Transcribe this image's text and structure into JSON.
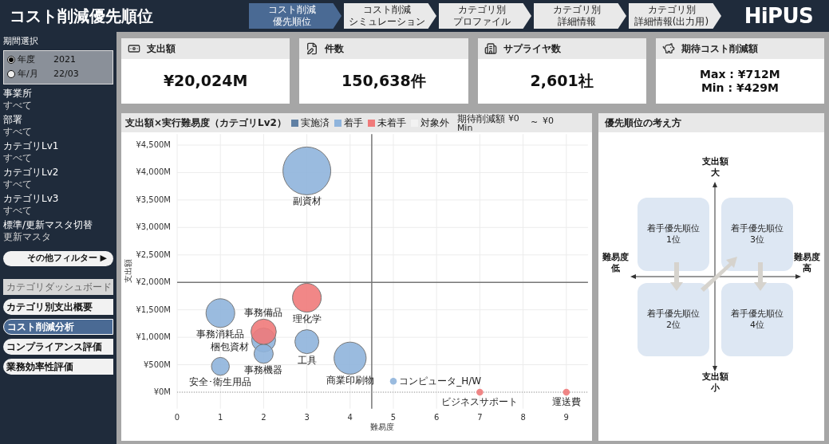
{
  "header": {
    "title": "コスト削減優先順位",
    "logo": "HiPUS"
  },
  "steps": [
    {
      "lines": [
        "コスト削減",
        "優先順位"
      ],
      "selected": true
    },
    {
      "lines": [
        "コスト削減",
        "シミュレーション"
      ],
      "selected": false
    },
    {
      "lines": [
        "カテゴリ別",
        "プロファイル"
      ],
      "selected": false
    },
    {
      "lines": [
        "カテゴリ別",
        "詳細情報"
      ],
      "selected": false
    },
    {
      "lines": [
        "カテゴリ別",
        "詳細情報(出力用)"
      ],
      "selected": false
    }
  ],
  "sidebar": {
    "period": {
      "label": "期間選択",
      "options": [
        {
          "label": "年度",
          "value": "2021",
          "selected": true
        },
        {
          "label": "年/月",
          "value": "22/03",
          "selected": false
        }
      ]
    },
    "filters": [
      {
        "label": "事業所",
        "value": "すべて"
      },
      {
        "label": "部署",
        "value": "すべて"
      },
      {
        "label": "カテゴリLv1",
        "value": "すべて"
      },
      {
        "label": "カテゴリLv2",
        "value": "すべて"
      },
      {
        "label": "カテゴリLv3",
        "value": "すべて"
      },
      {
        "label": "標準/更新マスタ切替",
        "value": "更新マスタ"
      }
    ],
    "more_filters": "その他フィルター ▶",
    "nav": [
      {
        "label": "カテゴリダッシュボード",
        "selected": false,
        "disabled": true
      },
      {
        "label": "カテゴリ別支出概要",
        "selected": false,
        "disabled": false
      },
      {
        "label": "コスト削減分析",
        "selected": true,
        "disabled": false
      },
      {
        "label": "コンプライアンス評価",
        "selected": false,
        "disabled": false
      },
      {
        "label": "業務効率性評価",
        "selected": false,
        "disabled": false
      }
    ]
  },
  "kpis": [
    {
      "kind": "money",
      "title": "支出額",
      "values": [
        "¥20,024M"
      ]
    },
    {
      "kind": "document",
      "title": "件数",
      "values": [
        "150,638件"
      ]
    },
    {
      "kind": "building",
      "title": "サプライヤ数",
      "values": [
        "2,601社"
      ]
    },
    {
      "kind": "piggy",
      "title": "期待コスト削減額",
      "values": [
        "Max : ¥712M",
        "Min : ¥429M"
      ]
    }
  ],
  "chart_panel": {
    "title": "支出額×実行難易度（カテゴリLv2）",
    "legend_before": [
      {
        "label": "実施済",
        "color": "#5f7fa3"
      }
    ],
    "legend_after": [
      {
        "label": "対象外",
        "color": "#f2f2f2"
      }
    ],
    "filter": {
      "label": "期待削減額",
      "min_value": "¥0",
      "min_label": "Min",
      "separator": "~",
      "max_value": "¥0"
    },
    "chart_data": {
      "type": "scatter",
      "xlabel": "難易度",
      "ylabel": "支出額",
      "xlim": [
        0,
        9.5
      ],
      "ylim": [
        -300,
        4700
      ],
      "grid": true,
      "xticks": [
        0,
        1,
        2,
        3,
        4,
        5,
        6,
        7,
        8,
        9
      ],
      "yticks": [
        {
          "value": 0,
          "label": "¥0M"
        },
        {
          "value": 500,
          "label": "¥500M"
        },
        {
          "value": 1000,
          "label": "¥1,000M"
        },
        {
          "value": 1500,
          "label": "¥1,500M"
        },
        {
          "value": 2000,
          "label": "¥2,000M"
        },
        {
          "value": 2500,
          "label": "¥2,500M"
        },
        {
          "value": 3000,
          "label": "¥3,000M"
        },
        {
          "value": 3500,
          "label": "¥3,500M"
        },
        {
          "value": 4000,
          "label": "¥4,000M"
        },
        {
          "value": 4500,
          "label": "¥4,500M"
        }
      ],
      "series": [
        {
          "name": "着手",
          "color": "#8fb4dc",
          "x": [
            3,
            1,
            2,
            2,
            3,
            1,
            4,
            5
          ],
          "values": [
            4030,
            1440,
            950,
            700,
            920,
            470,
            620,
            200
          ],
          "sizes": [
            1,
            0.36,
            0.25,
            0.16,
            0.25,
            0.14,
            0.45,
            0.02
          ],
          "value_labels": [
            "副資材",
            "事務消耗品",
            "梱包資材",
            "事務機器",
            "工具",
            "安全･衛生用品",
            "商業印刷物",
            "コンピュータ_H/W"
          ]
        },
        {
          "name": "未着手",
          "color": "#f07a7a",
          "x": [
            3,
            2,
            7,
            9
          ],
          "values": [
            1720,
            1100,
            0,
            0
          ],
          "sizes": [
            0.36,
            0.28,
            0.02,
            0.02
          ],
          "value_labels": [
            "理化学",
            "事務備品",
            "ビジネスサポート",
            "運送費"
          ]
        }
      ],
      "ref_lines": [
        {
          "axis": "x",
          "value": 4.5
        },
        {
          "axis": "y",
          "value": 2000
        },
        {
          "axis": "y",
          "value": 0
        }
      ]
    }
  },
  "priority_panel": {
    "title": "優先順位の考え方",
    "axis_labels": [
      {
        "lines": [
          "支出額",
          "大"
        ]
      },
      {
        "lines": [
          "支出額",
          "小"
        ]
      },
      {
        "lines": [
          "難易度",
          "低"
        ]
      },
      {
        "lines": [
          "難易度",
          "高"
        ]
      }
    ],
    "quadrants": [
      {
        "lines": [
          "着手優先順位",
          "1位"
        ]
      },
      {
        "lines": [
          "着手優先順位",
          "3位"
        ]
      },
      {
        "lines": [
          "着手優先順位",
          "2位"
        ]
      },
      {
        "lines": [
          "着手優先順位",
          "4位"
        ]
      }
    ]
  }
}
